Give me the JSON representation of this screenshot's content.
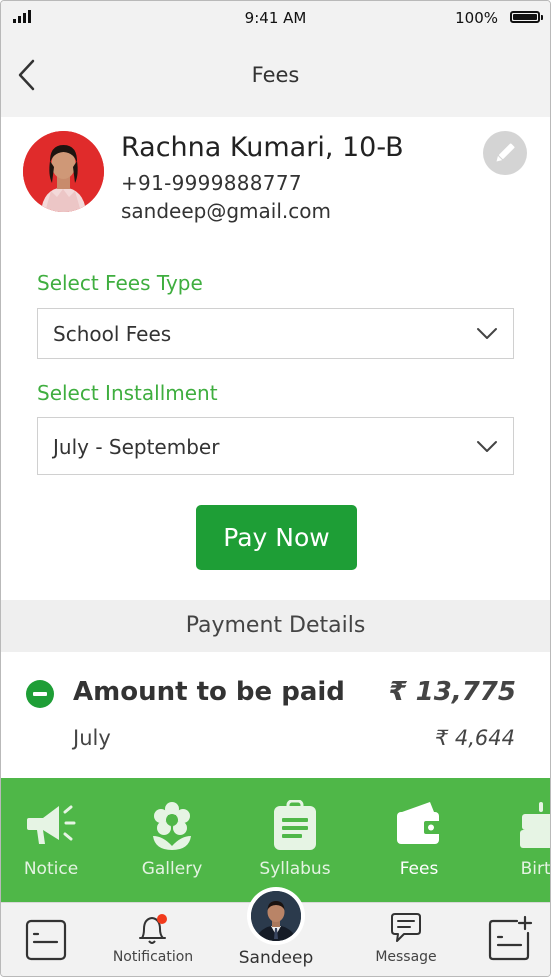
{
  "status_bar": {
    "time": "9:41 AM",
    "battery": "100%"
  },
  "nav": {
    "title": "Fees"
  },
  "student": {
    "name": "Rachna Kumari, 10-B",
    "phone": "+91-9999888777",
    "email": "sandeep@gmail.com"
  },
  "form": {
    "fees_type_label": "Select Fees Type",
    "fees_type_value": "School Fees",
    "installment_label": "Select Installment",
    "installment_value": "July - September",
    "pay_button": "Pay Now"
  },
  "payment": {
    "section_title": "Payment Details",
    "amount_label": "Amount to be paid",
    "amount_value": "₹ 13,775",
    "month_label": "July",
    "month_value": "₹ 4,644"
  },
  "features": [
    {
      "label": "Notice",
      "icon": "megaphone-icon"
    },
    {
      "label": "Gallery",
      "icon": "flower-icon"
    },
    {
      "label": "Syllabus",
      "icon": "document-icon"
    },
    {
      "label": "Fees",
      "icon": "wallet-icon",
      "active": true
    },
    {
      "label": "Birth",
      "icon": "cake-icon"
    }
  ],
  "tabbar": {
    "notification": "Notification",
    "profile": "Sandeep",
    "message": "Message"
  },
  "colors": {
    "accent_green": "#1e9e36",
    "feature_bar": "#4fb748",
    "label_green": "#3fae3f"
  }
}
